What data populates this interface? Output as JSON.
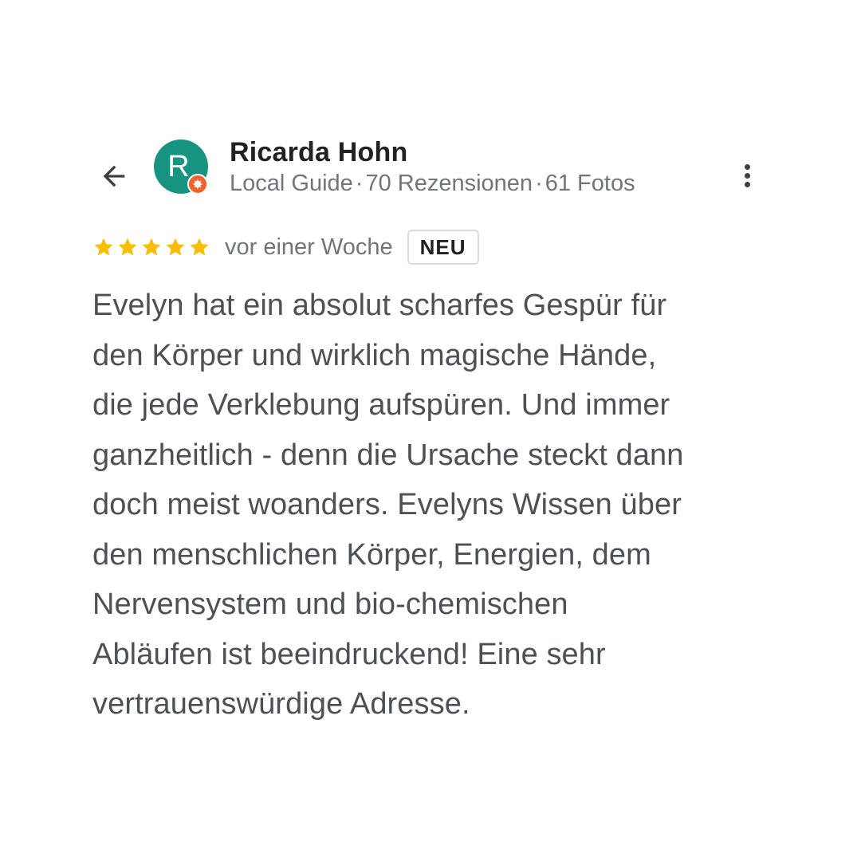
{
  "header": {
    "back_icon": "arrow-back-icon",
    "avatar_letter": "R",
    "avatar_color": "#179481",
    "badge_icon": "local-guide-badge-icon",
    "badge_color": "#f0642c",
    "user_name": "Ricarda Hohn",
    "meta": {
      "guide": "Local Guide",
      "reviews": "70 Rezensionen",
      "photos": "61 Fotos",
      "separator": "·"
    },
    "more_icon": "more-vert-icon"
  },
  "rating": {
    "stars": 5,
    "max_stars": 5,
    "star_color": "#fbbc04",
    "time": "vor einer Woche",
    "badge": "NEU"
  },
  "review": {
    "lines": [
      "Evelyn hat ein absolut scharfes Gespür für",
      "den Körper und wirklich magische Hände,",
      "die jede Verklebung aufspüren. Und immer",
      "ganzheitlich - denn die Ursache steckt dann",
      "doch meist woanders. Evelyns Wissen über",
      "den menschlichen Körper, Energien, dem",
      "Nervensystem und bio-chemischen",
      "Abläufen ist beeindruckend! Eine sehr",
      "vertrauenswürdige Adresse."
    ]
  }
}
